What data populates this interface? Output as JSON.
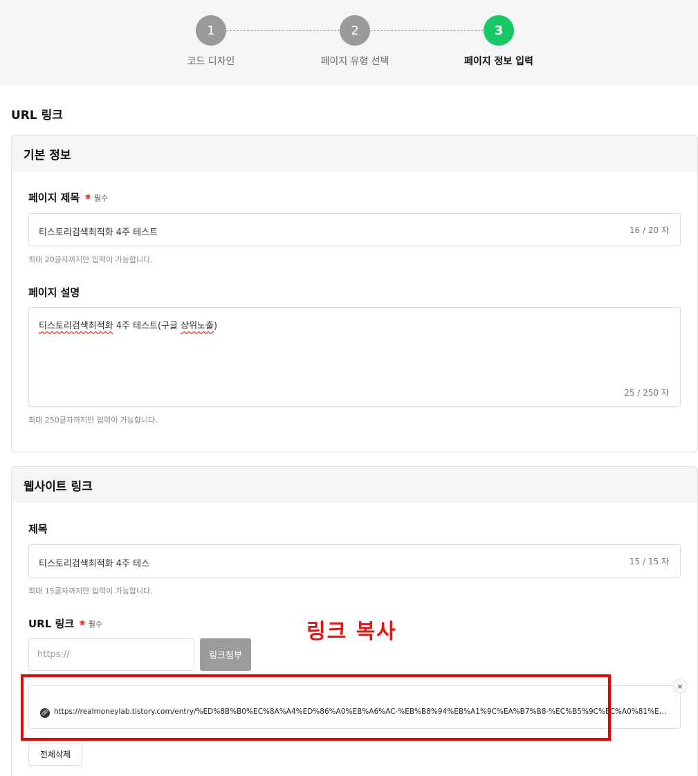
{
  "stepper": {
    "steps": [
      {
        "number": "1",
        "label": "코드 디자인"
      },
      {
        "number": "2",
        "label": "페이지 유형 선택"
      },
      {
        "number": "3",
        "label": "페이지 정보 입력"
      }
    ],
    "active_step": 3,
    "active_color": "#17c964",
    "inactive_color": "#9a9a9a"
  },
  "page_title": "URL 링크",
  "basic_info": {
    "heading": "기본 정보",
    "title_field": {
      "label": "페이지 제목",
      "required_mark": "⁕",
      "required_text": "필수",
      "value": "티스토리검색최적화 4주 테스트",
      "counter": "16 / 20 자",
      "hint": "최대 20글자까지만 입력이 가능합니다."
    },
    "desc_field": {
      "label": "페이지 설명",
      "value_underlined_1": "티스토리검색최적화",
      "value_middle": " 4주 테스트(구글 ",
      "value_underlined_2": "상위노출",
      "value_end": ")",
      "counter": "25 / 250 자",
      "hint": "최대 250글자까지만 입력이 가능합니다."
    }
  },
  "website_link": {
    "heading": "웹사이트 링크",
    "title_field": {
      "label": "제목",
      "value": "티스토리검색최적화 4주 테스",
      "counter": "15 / 15 자",
      "hint": "최대 15글자까지만 입력이 가능합니다."
    },
    "url_field": {
      "label": "URL 링크",
      "required_mark": "⁕",
      "required_text": "필수",
      "placeholder": "https://",
      "attach_label": "링크첨부"
    },
    "attached_link": {
      "url": "https://realmoneylab.tistory.com/entry/%ED%8B%B0%EC%8A%A4%ED%86%A0%EB%A6%AC-%EB%B8%94%EB%A1%9C%EA%B7%B8-%EC%B5%9C%EC%A0%81%ED%99%94-%E...",
      "remove_label": "×"
    },
    "delete_all_label": "전체삭제"
  },
  "annotation": {
    "text": "링크 복사",
    "color": "#ee1111"
  }
}
